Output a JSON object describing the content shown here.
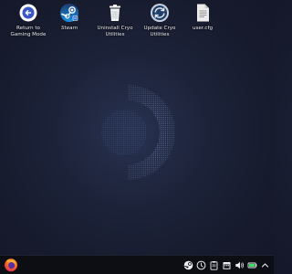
{
  "desktop": {
    "icons": [
      {
        "label": "Return to\nGaming Mode",
        "icon": "return-gaming-mode-icon",
        "color": "#ffffff"
      },
      {
        "label": "Steam",
        "icon": "steam-icon",
        "color": "#1b6fb8"
      },
      {
        "label": "Uninstall Cryo\nUtilities",
        "icon": "trash-icon",
        "color": "#ffffff"
      },
      {
        "label": "Update Cryo\nUtilities",
        "icon": "update-icon",
        "color": "#1f3a63"
      },
      {
        "label": "user.cfg",
        "icon": "text-file-icon",
        "color": "#e6e6e6"
      }
    ]
  },
  "taskbar": {
    "launcher_icon": "firefox-icon",
    "tray": [
      "steam-tray-icon",
      "update-tray-icon",
      "clipboard-icon",
      "calendar-icon",
      "volume-icon",
      "battery-icon",
      "chevron-up-icon"
    ]
  },
  "colors": {
    "background": "#161a2c",
    "taskbar": "#0d0e14",
    "accent": "#1a9fff"
  }
}
